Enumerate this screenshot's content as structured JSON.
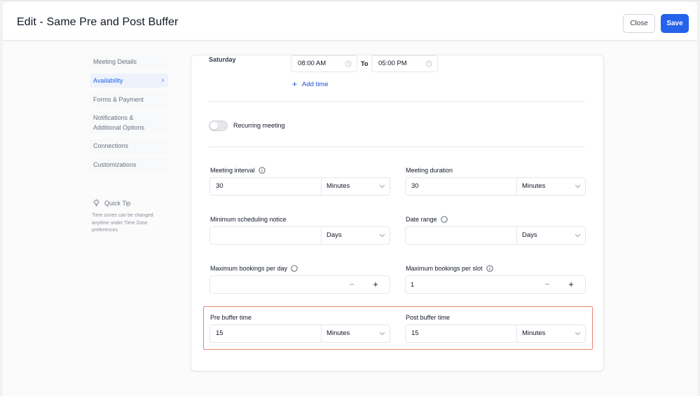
{
  "header": {
    "title": "Edit - Same Pre and Post Buffer",
    "close_label": "Close",
    "save_label": "Save"
  },
  "colors": {
    "accent": "#2563eb",
    "highlight_border": "#e8826f"
  },
  "sidebar": {
    "items": [
      {
        "label": "Meeting Details"
      },
      {
        "label": "Availability",
        "active": true
      },
      {
        "label": "Forms & Payment"
      },
      {
        "label": "Notifications & Additional Options"
      },
      {
        "label": "Connections"
      },
      {
        "label": "Customizations"
      }
    ],
    "tip_title": "Quick Tip",
    "tip_body": "Time zones can be changed anytime under Time Zone preferences",
    "tip_icon": "lightbulb-icon"
  },
  "availability": {
    "day": "Saturday",
    "start_time": "08:00 AM",
    "to_label": "To",
    "end_time": "05:00 PM",
    "add_time_label": "Add time",
    "recurring_label": "Recurring meeting",
    "recurring_on": false
  },
  "settings": {
    "meeting_interval": {
      "label": "Meeting interval",
      "value": "30",
      "unit": "Minutes"
    },
    "meeting_duration": {
      "label": "Meeting duration",
      "value": "30",
      "unit": "Minutes"
    },
    "min_notice": {
      "label": "Minimum scheduling notice",
      "value": "",
      "unit": "Days"
    },
    "date_range": {
      "label": "Date range",
      "value": "",
      "unit": "Days"
    },
    "max_per_day": {
      "label": "Maximum bookings per day",
      "value": "",
      "minus": "−",
      "plus": "+"
    },
    "max_per_slot": {
      "label": "Maximum bookings per slot",
      "value": "1",
      "minus": "−",
      "plus": "+"
    },
    "pre_buffer": {
      "label": "Pre buffer time",
      "value": "15",
      "unit": "Minutes"
    },
    "post_buffer": {
      "label": "Post buffer time",
      "value": "15",
      "unit": "Minutes"
    }
  }
}
